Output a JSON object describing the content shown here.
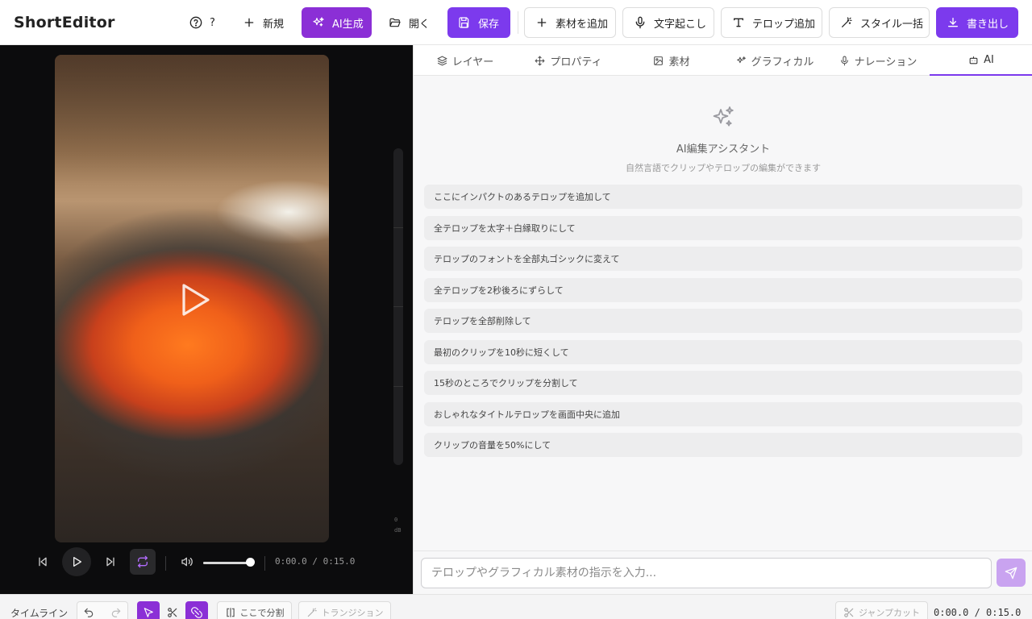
{
  "app": {
    "title": "ShortEditor"
  },
  "toolbar": {
    "help_label": "?",
    "new_label": "新規",
    "ai_generate_label": "AI生成",
    "open_label": "開く",
    "save_label": "保存",
    "add_media_label": "素材を追加",
    "transcribe_label": "文字起こし",
    "add_caption_label": "テロップ追加",
    "style_all_label": "スタイル一括",
    "export_label": "書き出し"
  },
  "player": {
    "time": "0:00.0 / 0:15.0",
    "volume": 0.98,
    "meter_label_top": "0",
    "meter_label_bottom": "dB"
  },
  "tabs": [
    {
      "label": "レイヤー",
      "icon": "layers-icon"
    },
    {
      "label": "プロパティ",
      "icon": "move-icon"
    },
    {
      "label": "素材",
      "icon": "image-icon"
    },
    {
      "label": "グラフィカル",
      "icon": "sparkles-icon"
    },
    {
      "label": "ナレーション",
      "icon": "mic-icon"
    },
    {
      "label": "AI",
      "icon": "bot-icon",
      "active": true
    }
  ],
  "ai": {
    "title": "AI編集アシスタント",
    "subtitle": "自然言語でクリップやテロップの編集ができます",
    "suggestions": [
      "ここにインパクトのあるテロップを追加して",
      "全テロップを太字＋白縁取りにして",
      "テロップのフォントを全部丸ゴシックに変えて",
      "全テロップを2秒後ろにずらして",
      "テロップを全部削除して",
      "最初のクリップを10秒に短くして",
      "15秒のところでクリップを分割して",
      "おしゃれなタイトルテロップを画面中央に追加",
      "クリップの音量を50%にして"
    ],
    "input_placeholder": "テロップやグラフィカル素材の指示を入力..."
  },
  "timeline": {
    "label": "タイムライン",
    "split_label": "ここで分割",
    "transition_label": "トランジション",
    "jumpcut_label": "ジャンプカット",
    "time": "0:00.0 / 0:15.0"
  },
  "colors": {
    "accent": "#7c3aed",
    "accent_alt": "#8b2fd6",
    "send_disabled": "#c9a3f0"
  }
}
